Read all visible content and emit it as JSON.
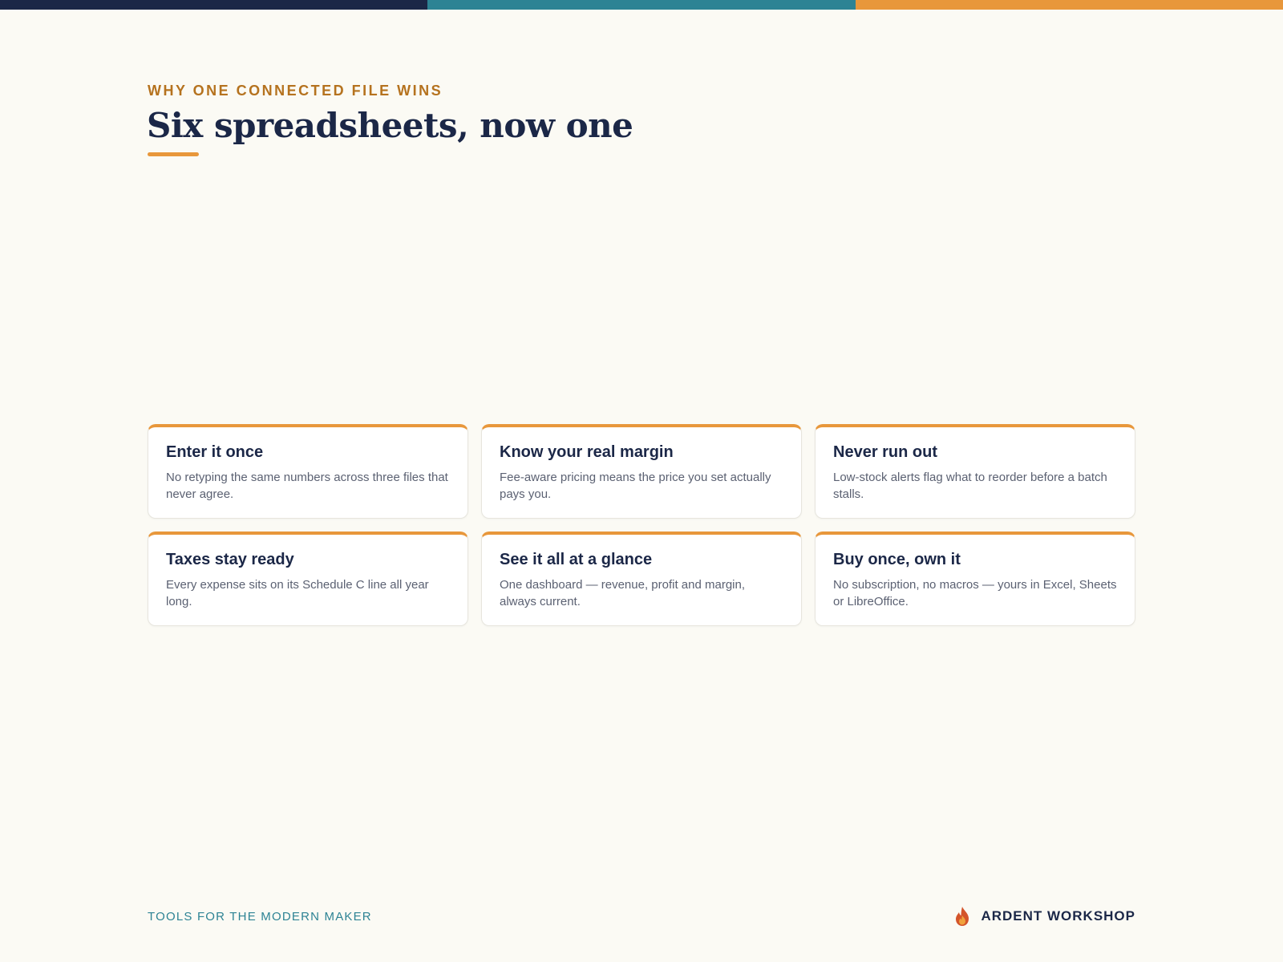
{
  "colors": {
    "navy": "#1b2747",
    "teal": "#2d8394",
    "orange": "#e8973b",
    "eyebrow": "#b5721e",
    "background": "#fbfaf4"
  },
  "header": {
    "eyebrow": "WHY ONE CONNECTED FILE WINS",
    "title": "Six spreadsheets, now one"
  },
  "cards": [
    {
      "title": "Enter it once",
      "body": "No retyping the same numbers across three files that never agree."
    },
    {
      "title": "Know your real margin",
      "body": "Fee-aware pricing means the price you set actually pays you."
    },
    {
      "title": "Never run out",
      "body": "Low-stock alerts flag what to reorder before a batch stalls."
    },
    {
      "title": "Taxes stay ready",
      "body": "Every expense sits on its Schedule C line all year long."
    },
    {
      "title": "See it all at a glance",
      "body": "One dashboard — revenue, profit and margin, always current."
    },
    {
      "title": "Buy once, own it",
      "body": "No subscription, no macros — yours in Excel, Sheets or LibreOffice."
    }
  ],
  "footer": {
    "tagline": "TOOLS FOR THE MODERN MAKER",
    "brand": "ARDENT WORKSHOP",
    "brand_icon": "flame-icon"
  }
}
